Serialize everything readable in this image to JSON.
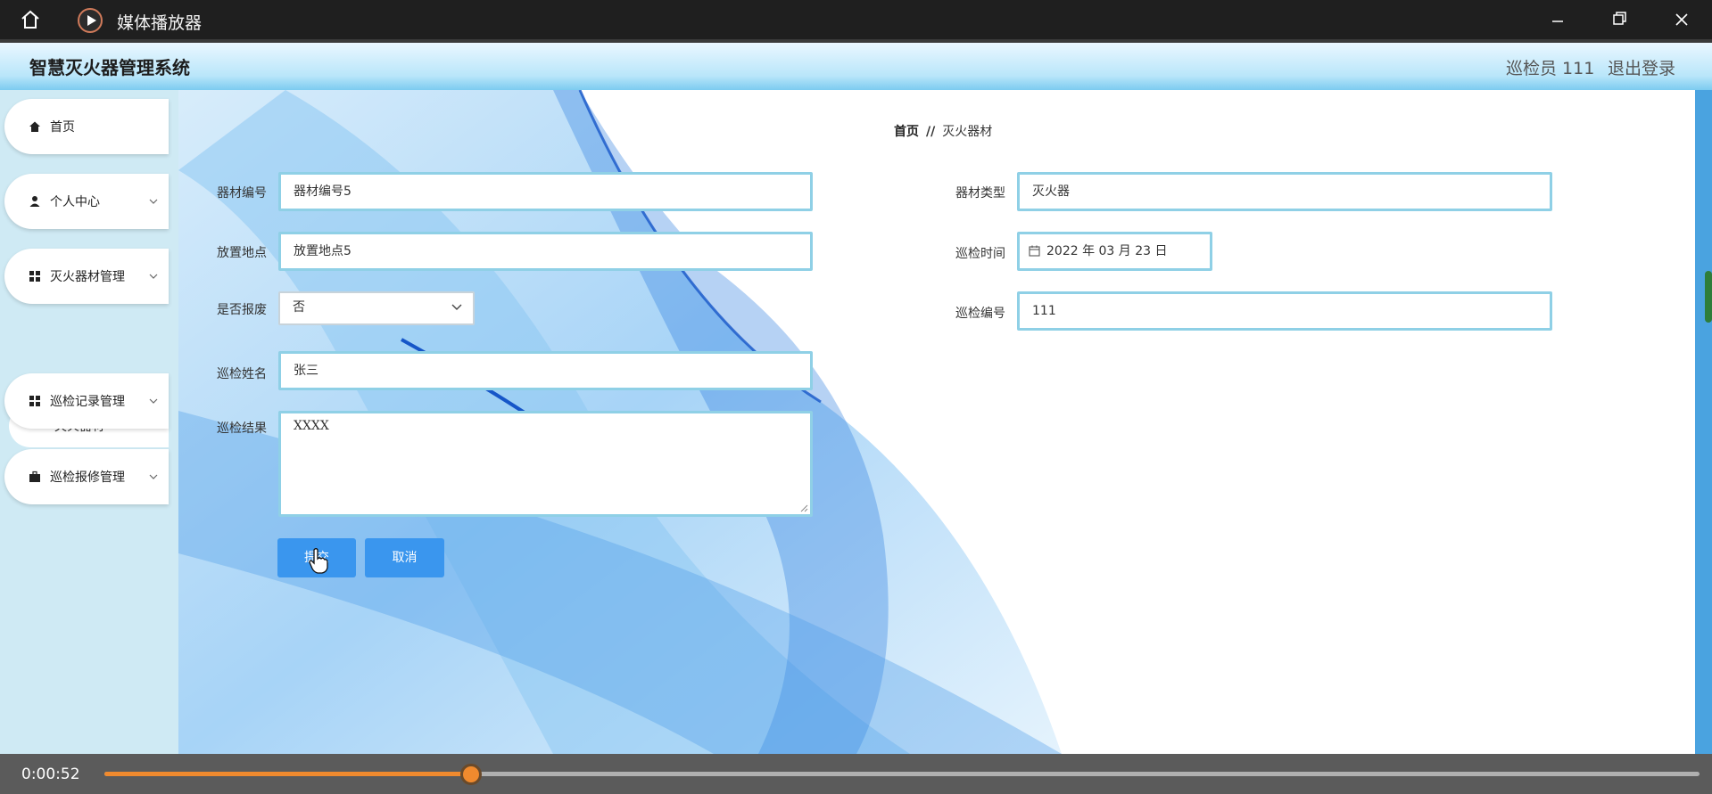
{
  "window": {
    "app_name": "媒体播放器"
  },
  "header": {
    "system_title": "智慧灭火器管理系统",
    "user": "巡检员 111",
    "logout": "退出登录"
  },
  "sidebar": {
    "items": [
      {
        "label": "首页",
        "icon": "home-icon"
      },
      {
        "label": "个人中心",
        "icon": "user-icon"
      },
      {
        "label": "灭火器材管理",
        "icon": "grid-icon"
      },
      {
        "label": "巡检记录管理",
        "icon": "grid-icon"
      },
      {
        "label": "巡检报修管理",
        "icon": "briefcase-icon"
      }
    ],
    "submenu_item": "灭火器材"
  },
  "breadcrumb": {
    "home": "首页",
    "separator": "//",
    "current": "灭火器材"
  },
  "form": {
    "equipment_no_label": "器材编号",
    "equipment_no_value": "器材编号5",
    "location_label": "放置地点",
    "location_value": "放置地点5",
    "scrapped_label": "是否报废",
    "scrapped_value": "否",
    "inspector_name_label": "巡检姓名",
    "inspector_name_value": "张三",
    "result_label": "巡检结果",
    "result_value": "XXXX",
    "type_label": "器材类型",
    "type_value": "灭火器",
    "time_label": "巡检时间",
    "time_value": "2022 年 03 月 23 日",
    "inspector_no_label": "巡检编号",
    "inspector_no_value": "111",
    "submit_label": "提交",
    "cancel_label": "取消"
  },
  "media": {
    "time": "0:00:52",
    "progress": 0.23
  },
  "colors": {
    "accent": "#3a96ee",
    "input_border": "#8fd0e6",
    "progress": "#f08a2e"
  }
}
